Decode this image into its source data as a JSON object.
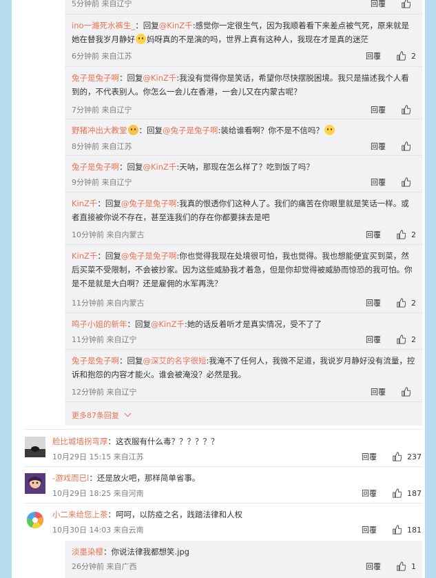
{
  "replies": [
    {
      "user": "",
      "prefix": "",
      "target": "",
      "text": "",
      "time": "5分钟前 来自辽宁",
      "likes": "",
      "reply_label": "回覆"
    },
    {
      "user": "ino一濰死水裤生_",
      "prefix": "：回复",
      "target": "@KinZ千",
      "text": ":感觉你一定很生气，因为我顺着看下来差点被气死，原来就是她在替我岁月静好",
      "text2": "妈呀真的不是演的吗，世界上真有这种人，我现在才是真的迷茫",
      "time": "6分钟前 来自江苏",
      "likes": "2",
      "reply_label": "回覆"
    },
    {
      "user": "兔子是兔子啊",
      "prefix": "：回复",
      "target": "@KinZ千",
      "text": ":我没有觉得你是笑话，希望你尽快摆脱困境。我只是描述我个人看到的，不代表别人。你怎么一会儿在香港，一会儿又在内蒙古呢？",
      "time": "7分钟前 来自辽宁",
      "likes": "",
      "reply_label": "回覆"
    },
    {
      "user": "野猪冲出大教堂",
      "prefix": "：回复",
      "target": "@兔子是兔子啊",
      "text": ":装给谁看啊？你不是不信吗？",
      "time": "8分钟前 来自江苏",
      "likes": "",
      "reply_label": "回覆"
    },
    {
      "user": "兔子是兔子啊",
      "prefix": "：回复",
      "target": "@KinZ千",
      "text": ":天呐，那现在怎么样了？吃到饭了吗？",
      "time": "9分钟前 来自辽宁",
      "likes": "",
      "reply_label": "回覆"
    },
    {
      "user": "KinZ千",
      "prefix": "：回复",
      "target": "@兔子是兔子啊",
      "text": ":我真的恨透你们这种人了。我们的痛苦在你眼里就是笑话一样。或者直接被你说不存在，甚至连我们的存在你都要抹去是吧",
      "time": "10分钟前 来自内蒙古",
      "likes": "2",
      "reply_label": "回覆"
    },
    {
      "user": "KinZ千",
      "prefix": "：回复",
      "target": "@兔子是兔子啊",
      "text": ":你也觉得我现在处境很可怕，我也觉得。我也想能便宜买到菜，然后买菜不受限制，不会被抄家。因为这些威胁我才着急，但是你却觉得被威胁而惊恐的我可怕。你是不是就是大白啊？还是雇佣的水军再洗？",
      "time": "11分钟前 来自内蒙古",
      "likes": "2",
      "reply_label": "回覆"
    },
    {
      "user": "鸣子小姐的新年",
      "prefix": "：回复",
      "target": "@KinZ千",
      "text": ":她的话反着听才是真实情况，受不了了",
      "time": "11分钟前 来自辽宁",
      "likes": "2",
      "reply_label": "回覆"
    },
    {
      "user": "兔子是兔子啊",
      "prefix": "：回复",
      "target": "@深艾的名字很短",
      "text": ":我淹不了任何人，我微不足道，我说岁月静好没有流量，控诉和抱怨的内容才能火。谁会被淹没？必然是我。",
      "time": "12分钟前 来自辽宁",
      "likes": "",
      "reply_label": "回覆"
    }
  ],
  "more_label": "更多87条回复",
  "comments": [
    {
      "user": "脸比城墙拐弯厚",
      "text": "：这衣服有什么毒？？？？？？",
      "time": "10月29日 15:15 来自江苏",
      "likes": "237",
      "reply_label": "回覆"
    },
    {
      "user": "-游戏而已l",
      "text": "：还是放火吧，那样简单省事。",
      "time": "10月29日 18:25 来自河南",
      "likes": "187",
      "reply_label": "回覆"
    },
    {
      "user": "小二来给您上茶",
      "text": "：呵呵，以防疫之名，践踏法律和人权",
      "time": "10月30日 14:03 来自云南",
      "likes": "181",
      "reply_label": "回覆"
    }
  ],
  "last_reply": {
    "user": "淡墨染樱",
    "text": "：你说法律我都想笑.jpg",
    "time": "26分钟前 来自广西",
    "likes": "1",
    "reply_label": "回覆"
  },
  "colors": {
    "accent": "#eb7350",
    "background": "#b9dbef",
    "reply_box": "#f2f2f5"
  }
}
